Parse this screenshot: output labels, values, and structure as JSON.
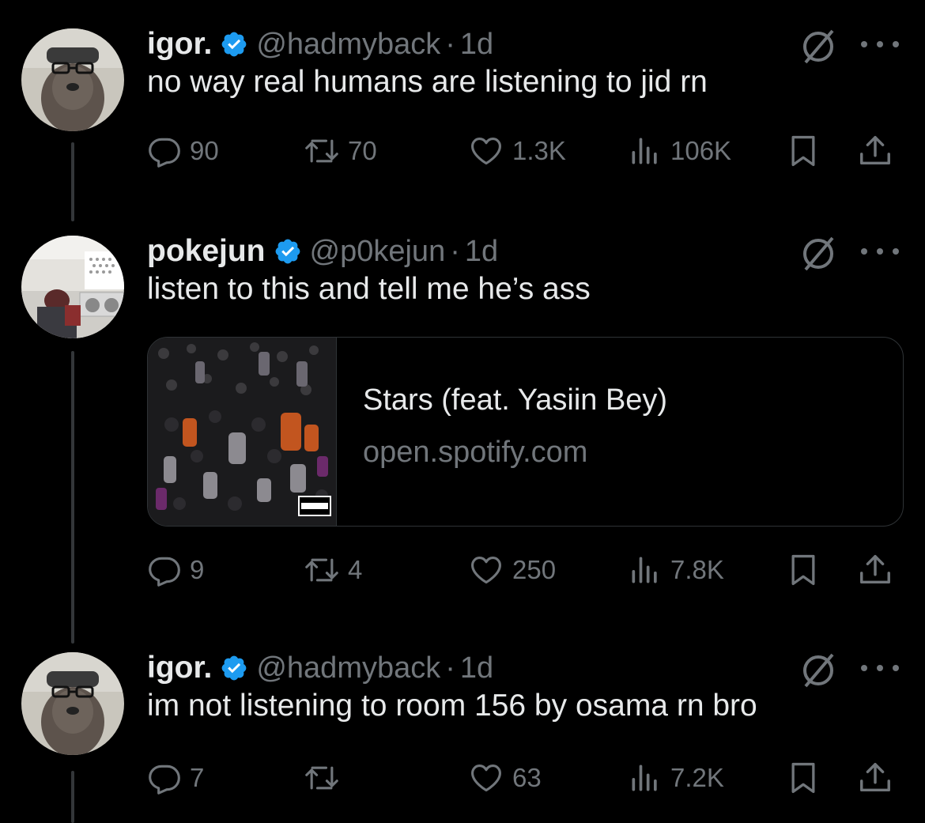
{
  "colors": {
    "background": "#000000",
    "primary_text": "#e7e9ea",
    "secondary_text": "#71767b",
    "verified_badge": "#1d9bf0",
    "thread_line": "#333639"
  },
  "tweets": [
    {
      "author": {
        "name": "igor.",
        "handle": "@hadmyback",
        "verified": true,
        "avatar": "bulldog-with-glasses-avatar"
      },
      "separator": "·",
      "time": "1d",
      "text": "no way real humans are listening to jid rn",
      "stats": {
        "replies": "90",
        "reposts": "70",
        "likes": "1.3K",
        "views": "106K"
      }
    },
    {
      "author": {
        "name": "pokejun",
        "handle": "@p0kejun",
        "verified": true,
        "avatar": "laundromat-photo-avatar"
      },
      "separator": "·",
      "time": "1d",
      "text": "listen to this and tell me he’s ass",
      "card": {
        "title": "Stars (feat. Yasiin Bey)",
        "domain": "open.spotify.com",
        "art": "album-cover-crowd-art"
      },
      "stats": {
        "replies": "9",
        "reposts": "4",
        "likes": "250",
        "views": "7.8K"
      }
    },
    {
      "author": {
        "name": "igor.",
        "handle": "@hadmyback",
        "verified": true,
        "avatar": "bulldog-with-glasses-avatar"
      },
      "separator": "·",
      "time": "1d",
      "text": "im not listening to room 156 by osama rn bro",
      "stats": {
        "replies": "7",
        "reposts": "",
        "likes": "63",
        "views": "7.2K"
      }
    }
  ]
}
